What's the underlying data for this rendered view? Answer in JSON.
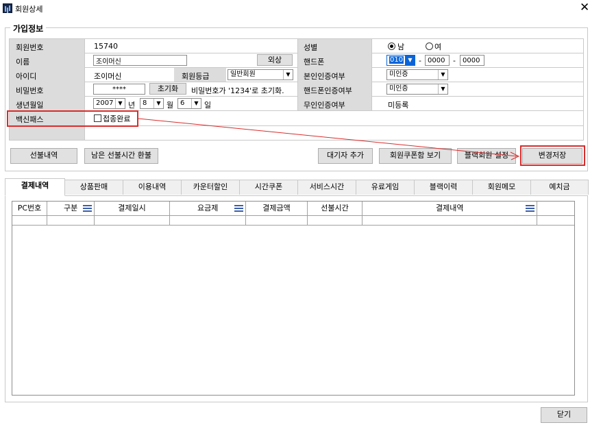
{
  "window": {
    "title": "회원상세"
  },
  "group": {
    "title": "가입정보"
  },
  "labels": {
    "member_no": "회원번호",
    "name": "이름",
    "user_id": "아이디",
    "password": "비밀번호",
    "birthdate": "생년월일",
    "vaccine_pass": "백신패스",
    "gender": "성별",
    "phone": "핸드폰",
    "identity_verified": "본인인증여부",
    "phone_verified": "핸드폰인증여부",
    "unmanned_verified": "무인인증여부",
    "member_grade": "회원등급"
  },
  "values": {
    "member_no": "15740",
    "name": "조이머신",
    "user_id": "조이머신",
    "member_grade": "일반회원",
    "password_mask": "****",
    "password_hint": "비밀번호가 '1234'로 초기화.",
    "birth_year": "2007",
    "birth_year_unit": "년",
    "birth_month": "8",
    "birth_month_unit": "월",
    "birth_day": "6",
    "birth_day_unit": "일",
    "gender_male": "남",
    "gender_female": "여",
    "gender_selected": "남",
    "phone_prefix": "010",
    "phone_mid": "0000",
    "phone_last": "0000",
    "phone_dash": "-",
    "identity_verified": "미인증",
    "phone_verified": "미인증",
    "unmanned_verified": "미등록",
    "vaccine_checkbox_label": "접종완료",
    "vaccine_checked": false
  },
  "buttons": {
    "credit": "외상",
    "reset_password": "초기화",
    "prepaid_history": "선불내역",
    "refund_prepaid": "남은 선불시간 환불",
    "add_waiting": "대기자 추가",
    "view_coupons": "회원쿠폰함 보기",
    "block_member": "블랙회원 설정",
    "save_changes": "변경저장",
    "close": "닫기"
  },
  "tabs": [
    {
      "label": "결제내역",
      "active": true
    },
    {
      "label": "상품판매",
      "active": false
    },
    {
      "label": "이용내역",
      "active": false
    },
    {
      "label": "카운터할인",
      "active": false
    },
    {
      "label": "시간쿠폰",
      "active": false
    },
    {
      "label": "서비스시간",
      "active": false
    },
    {
      "label": "유료게임",
      "active": false
    },
    {
      "label": "블랙이력",
      "active": false
    },
    {
      "label": "회원메모",
      "active": false
    },
    {
      "label": "예치금",
      "active": false
    }
  ],
  "grid": {
    "columns": [
      "PC번호",
      "구분",
      "결제일시",
      "요금제",
      "결제금액",
      "선불시간",
      "결제내역"
    ],
    "rows": []
  },
  "colors": {
    "highlight": "#d92b2b",
    "label_bg": "#dcdcdc",
    "selected_combo": "#0a64d8"
  }
}
